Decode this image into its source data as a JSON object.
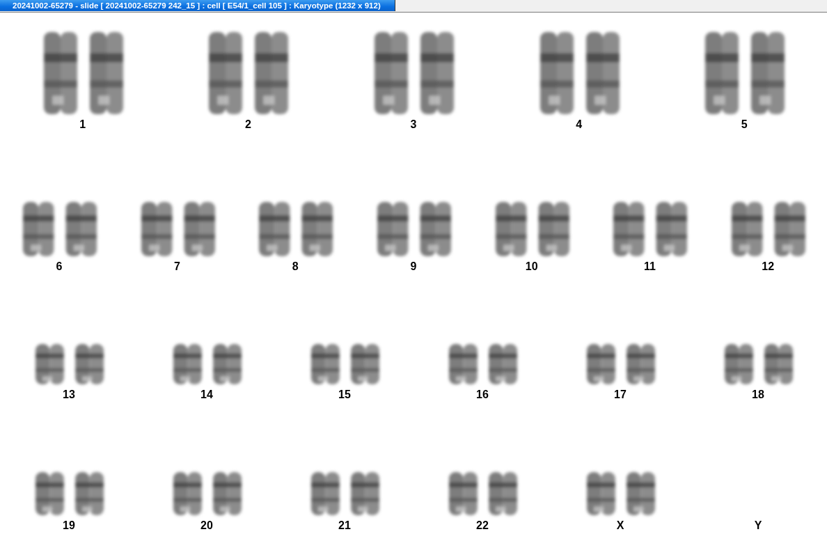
{
  "window": {
    "title": "20241002-65279 - slide [ 20241002-65279 242_15 ] : cell [ E54/1_cell 105 ] : Karyotype  (1232 x 912)"
  },
  "karyotype": {
    "rows": [
      [
        {
          "label": "1",
          "kind": "pair"
        },
        {
          "label": "2",
          "kind": "pair"
        },
        {
          "label": "3",
          "kind": "pair"
        },
        {
          "label": "4",
          "kind": "pair"
        },
        {
          "label": "5",
          "kind": "pair"
        }
      ],
      [
        {
          "label": "6",
          "kind": "pair"
        },
        {
          "label": "7",
          "kind": "pair"
        },
        {
          "label": "8",
          "kind": "pair"
        },
        {
          "label": "9",
          "kind": "pair"
        },
        {
          "label": "10",
          "kind": "pair"
        },
        {
          "label": "11",
          "kind": "pair"
        },
        {
          "label": "12",
          "kind": "pair"
        }
      ],
      [
        {
          "label": "13",
          "kind": "pair"
        },
        {
          "label": "14",
          "kind": "pair"
        },
        {
          "label": "15",
          "kind": "pair"
        },
        {
          "label": "16",
          "kind": "pair"
        },
        {
          "label": "17",
          "kind": "pair"
        },
        {
          "label": "18",
          "kind": "pair"
        }
      ],
      [
        {
          "label": "19",
          "kind": "pair"
        },
        {
          "label": "20",
          "kind": "pair"
        },
        {
          "label": "21",
          "kind": "pair"
        },
        {
          "label": "22",
          "kind": "pair"
        },
        {
          "label": "X",
          "kind": "pair"
        },
        {
          "label": "Y",
          "kind": "empty"
        }
      ]
    ]
  }
}
